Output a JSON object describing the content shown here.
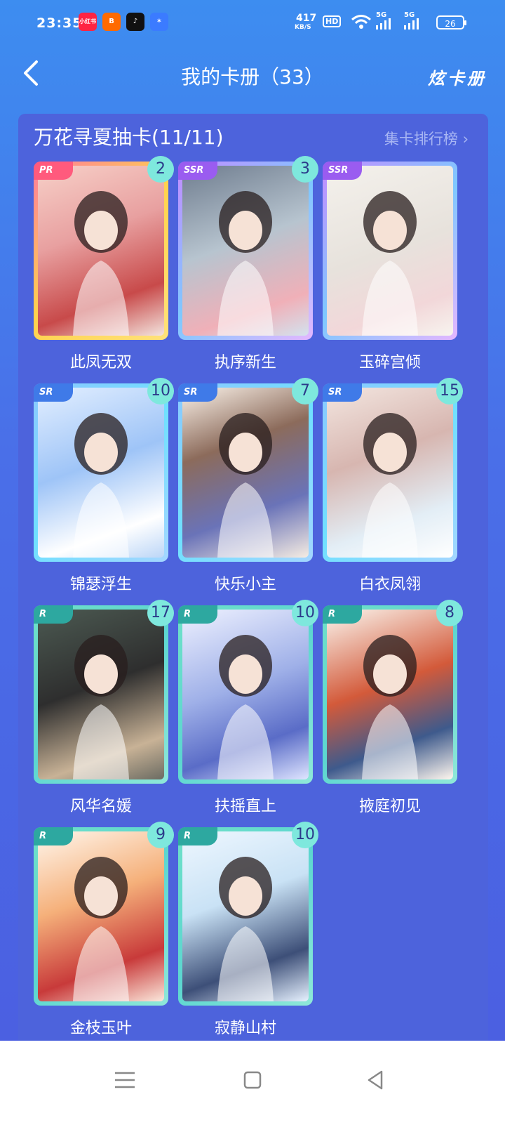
{
  "status_bar": {
    "time": "23:35",
    "apps": [
      {
        "name": "小红书",
        "color": "#ff2442"
      },
      {
        "name": "B",
        "color": "#ff6a00"
      },
      {
        "name": "♪",
        "color": "#111111"
      },
      {
        "name": "✶",
        "color": "#3b7bff"
      }
    ],
    "net_speed": "417",
    "net_unit": "KB/S",
    "hd": "HD",
    "signal1": "5G",
    "signal2": "5G",
    "battery": "26"
  },
  "header": {
    "back_icon": "chevron-left-icon",
    "title": "我的卡册（33）",
    "action": "炫卡册"
  },
  "collection": {
    "title": "万花寻夏抽卡(11/11)",
    "rank_link": "集卡排行榜",
    "cards": [
      {
        "name": "此凤无双",
        "rarity": "PR",
        "count": "2"
      },
      {
        "name": "执序新生",
        "rarity": "SSR",
        "count": "3"
      },
      {
        "name": "玉碎宫倾",
        "rarity": "SSR",
        "count": ""
      },
      {
        "name": "锦瑟浮生",
        "rarity": "SR",
        "count": "10"
      },
      {
        "name": "快乐小主",
        "rarity": "SR",
        "count": "7"
      },
      {
        "name": "白衣凤翎",
        "rarity": "SR",
        "count": "15"
      },
      {
        "name": "风华名媛",
        "rarity": "R",
        "count": "17"
      },
      {
        "name": "扶摇直上",
        "rarity": "R",
        "count": "10"
      },
      {
        "name": "掖庭初见",
        "rarity": "R",
        "count": "8"
      },
      {
        "name": "金枝玉叶",
        "rarity": "R",
        "count": "9"
      },
      {
        "name": "寂静山村",
        "rarity": "R",
        "count": "10"
      }
    ]
  },
  "nav": {
    "menu_icon": "menu-icon",
    "home_icon": "square-home-icon",
    "back_icon": "triangle-back-icon"
  }
}
